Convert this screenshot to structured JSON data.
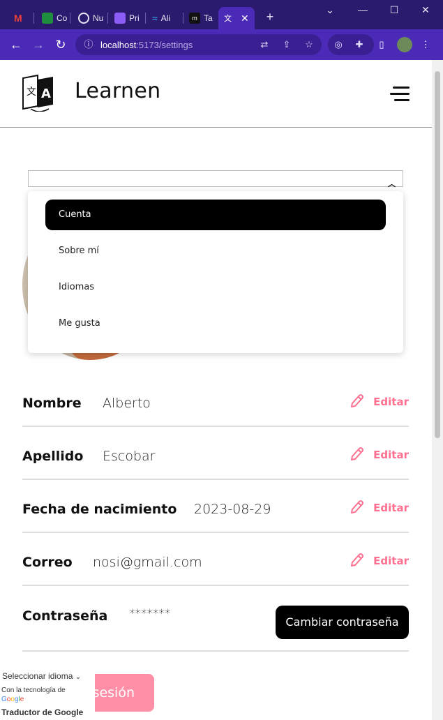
{
  "browser": {
    "tabs": [
      {
        "label": "",
        "icon": "gmail-icon",
        "color": "#ea4335"
      },
      {
        "label": "Co",
        "icon": "sheets-icon",
        "color": "#1e8e3e"
      },
      {
        "label": "Nu",
        "icon": "chrome-icon",
        "color": "#e8e6f5"
      },
      {
        "label": "Pri",
        "icon": "app-icon",
        "color": "#8b5cf6"
      },
      {
        "label": "Ali",
        "icon": "tailwind-icon",
        "color": "#38bdf8"
      },
      {
        "label": "Ta",
        "icon": "notion-icon",
        "color": "#111111"
      },
      {
        "label": "",
        "icon": "learnen-icon",
        "color": "#ffffff"
      }
    ],
    "new_tab": "+",
    "url_host": "localhost",
    "url_path": ":5173/settings"
  },
  "app": {
    "brand": "Learnen",
    "accent_color": "#ff6f8f"
  },
  "settings_menu": {
    "items": [
      {
        "label": "Cuenta",
        "active": true
      },
      {
        "label": "Sobre mí",
        "active": false
      },
      {
        "label": "Idiomas",
        "active": false
      },
      {
        "label": "Me gusta",
        "active": false
      }
    ]
  },
  "profile": {
    "rows": [
      {
        "label": "Nombre",
        "value": "Alberto",
        "action": "Editar"
      },
      {
        "label": "Apellido",
        "value": "Escobar",
        "action": "Editar"
      },
      {
        "label": "Fecha de nacimiento",
        "value": "2023-08-29",
        "action": "Editar"
      },
      {
        "label": "Correo",
        "value": "nosi@gmail.com",
        "action": "Editar"
      }
    ],
    "password_label": "Contraseña",
    "password_value": "*******",
    "change_password_button": "Cambiar contraseña",
    "logout_button_visible_text": "sesión"
  },
  "google_translate": {
    "select_label": "Seleccionar idioma",
    "powered_by": "Con la tecnología de",
    "logo_text": "Google",
    "name": "Traductor de Google"
  }
}
